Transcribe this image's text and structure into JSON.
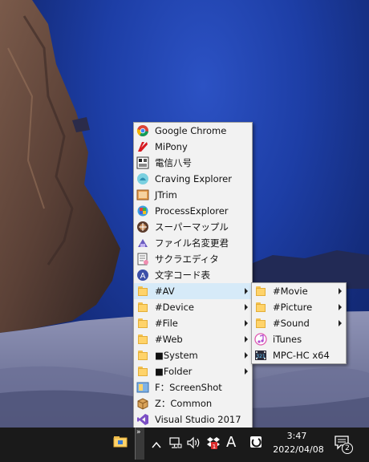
{
  "main_menu": {
    "items": [
      {
        "label": "Google Chrome",
        "icon": "chrome-icon",
        "submenu": false
      },
      {
        "label": "MiPony",
        "icon": "mipony-icon",
        "submenu": false
      },
      {
        "label": "電信八号",
        "icon": "denshin-icon",
        "submenu": false
      },
      {
        "label": "Craving Explorer",
        "icon": "craving-explorer-icon",
        "submenu": false
      },
      {
        "label": "JTrim",
        "icon": "jtrim-icon",
        "submenu": false
      },
      {
        "label": "ProcessExplorer",
        "icon": "process-explorer-icon",
        "submenu": false
      },
      {
        "label": "スーパーマップル",
        "icon": "supermapple-icon",
        "submenu": false
      },
      {
        "label": "ファイル名変更君",
        "icon": "rename-icon",
        "submenu": false
      },
      {
        "label": "サクラエディタ",
        "icon": "sakura-editor-icon",
        "submenu": false
      },
      {
        "label": "文字コード表",
        "icon": "charmap-icon",
        "submenu": false
      },
      {
        "label": "#AV",
        "icon": "folder-icon",
        "submenu": true,
        "highlighted": true
      },
      {
        "label": "#Device",
        "icon": "folder-icon",
        "submenu": true
      },
      {
        "label": "#File",
        "icon": "folder-icon",
        "submenu": true
      },
      {
        "label": "#Web",
        "icon": "folder-icon",
        "submenu": true
      },
      {
        "label": "■System",
        "icon": "folder-icon",
        "submenu": true
      },
      {
        "label": "■Folder",
        "icon": "folder-icon",
        "submenu": true
      },
      {
        "label": "F：ScreenShot",
        "icon": "drive-icon",
        "submenu": false
      },
      {
        "label": "Z：Common",
        "icon": "box-icon",
        "submenu": false
      },
      {
        "label": "Visual Studio 2017",
        "icon": "visual-studio-icon",
        "submenu": false
      }
    ]
  },
  "av_submenu": {
    "items": [
      {
        "label": "#Movie",
        "icon": "folder-icon",
        "submenu": true
      },
      {
        "label": "#Picture",
        "icon": "folder-icon",
        "submenu": true
      },
      {
        "label": "#Sound",
        "icon": "folder-icon",
        "submenu": true
      },
      {
        "label": "iTunes",
        "icon": "itunes-icon",
        "submenu": false
      },
      {
        "label": "MPC-HC x64",
        "icon": "mpc-hc-icon",
        "submenu": false
      }
    ]
  },
  "taskbar": {
    "toolbar_chevron": "»",
    "tray": {
      "ime_mode": "A",
      "notification_count": "2"
    },
    "clock": {
      "time": "3:47",
      "date": "2022/04/08"
    }
  },
  "colors": {
    "menu_bg": "#f2f2f2",
    "menu_highlight": "#d6eaf8",
    "taskbar_bg": "#1a1a1a",
    "wallpaper_sea": "#1d3ea6"
  }
}
